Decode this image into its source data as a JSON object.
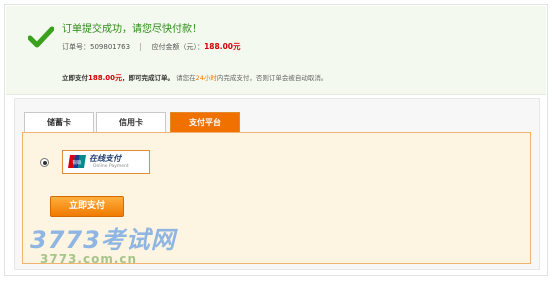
{
  "banner": {
    "title": "订单提交成功，请您尽快付款！",
    "order_no_label": "订单号：",
    "order_no": "509801763",
    "amount_label": "应付金额（元）：",
    "amount": "188.00元",
    "pay_prefix": "立即支付",
    "pay_amount": "188.00元",
    "pay_bold": "，即可完成订单。",
    "pay_note_1": "请您在",
    "pay_hours": "24小时",
    "pay_note_2": "内完成支付，否则订单会被自动取消。"
  },
  "tabs": [
    {
      "label": "储蓄卡",
      "active": false
    },
    {
      "label": "信用卡",
      "active": false
    },
    {
      "label": "支付平台",
      "active": true
    }
  ],
  "payment_option": {
    "name_cn": "在线支付",
    "name_en": "Online Payment",
    "logo_text": "银联"
  },
  "pay_button_label": "立即支付",
  "watermark": {
    "logo": "3773考试网",
    "url": "3773.com.cn"
  },
  "colors": {
    "accent": "#f07000",
    "success": "#2e8b19",
    "price": "#d40000"
  }
}
